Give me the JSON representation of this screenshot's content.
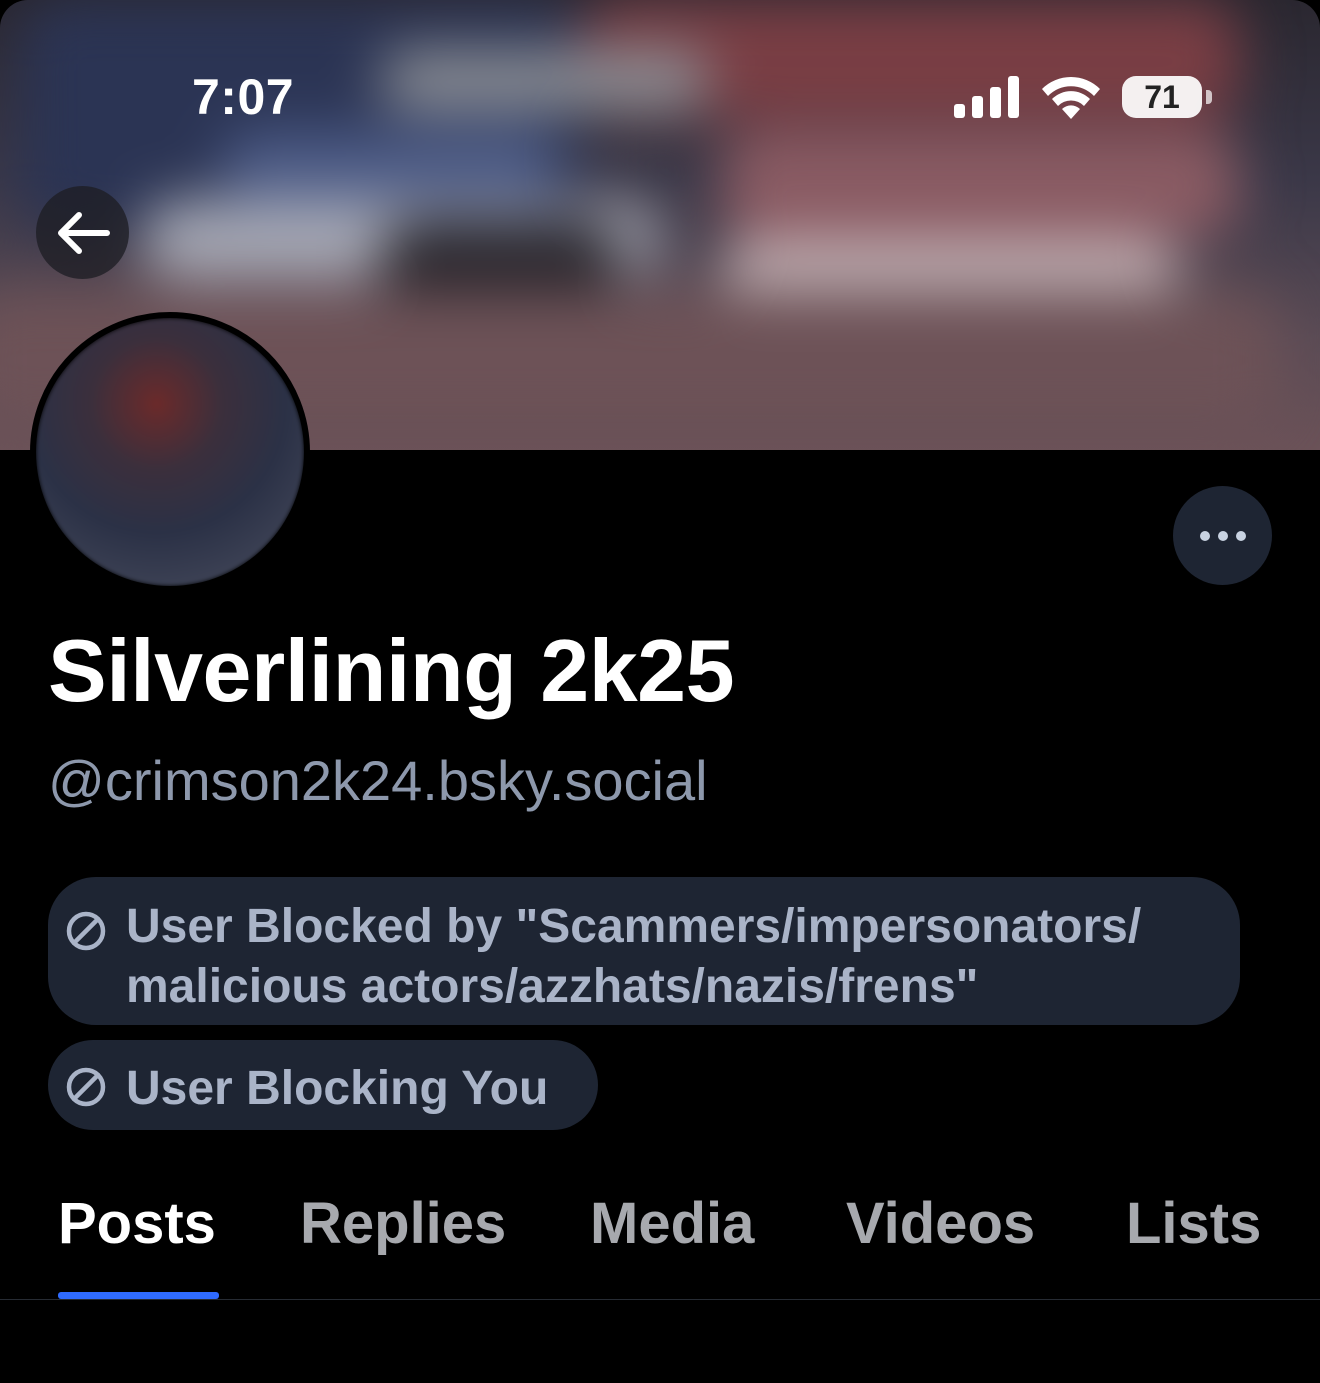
{
  "status_bar": {
    "time": "7:07",
    "battery": "71",
    "icons": [
      "cellular-signal-icon",
      "wifi-icon",
      "battery-icon"
    ]
  },
  "header": {
    "back_icon": "arrow-left-icon",
    "more_icon": "ellipsis-icon"
  },
  "profile": {
    "display_name": "Silverlining 2k25",
    "handle": "@crimson2k24.bsky.social"
  },
  "labels": [
    {
      "icon": "blocked-icon",
      "line1": "User Blocked by \"Scammers/impersonators/",
      "line2": "malicious actors/azzhats/nazis/frens\""
    },
    {
      "icon": "blocked-icon",
      "text": "User Blocking You"
    }
  ],
  "tabs": [
    {
      "label": "Posts",
      "active": true
    },
    {
      "label": "Replies",
      "active": false
    },
    {
      "label": "Media",
      "active": false
    },
    {
      "label": "Videos",
      "active": false
    },
    {
      "label": "Lists",
      "active": false
    }
  ],
  "colors": {
    "background": "#000000",
    "pill_bg": "#1e2533",
    "accent": "#2f6bff",
    "handle_text": "#8d98ac",
    "label_text": "#aab4c8",
    "inactive_tab": "#a7a9ae"
  }
}
